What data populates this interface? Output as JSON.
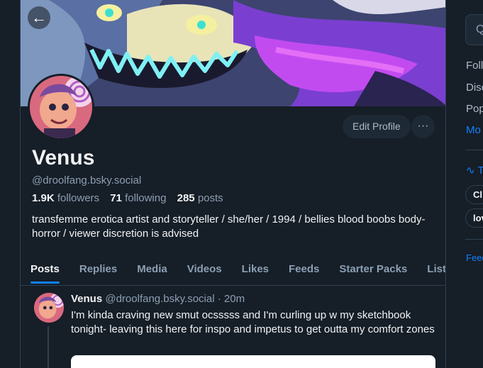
{
  "profile": {
    "display_name": "Venus",
    "handle": "@droolfang.bsky.social",
    "followers_count": "1.9K",
    "followers_label": "followers",
    "following_count": "71",
    "following_label": "following",
    "posts_count": "285",
    "posts_label": "posts",
    "bio": "transfemme erotica artist and storyteller / she/her / 1994 / bellies blood boobs body-horror / viewer discretion is advised",
    "edit_label": "Edit Profile",
    "more_label": "···",
    "back_icon": "arrow-left-icon"
  },
  "tabs": [
    "Posts",
    "Replies",
    "Media",
    "Videos",
    "Likes",
    "Feeds",
    "Starter Packs",
    "Lists"
  ],
  "post": {
    "author": "Venus",
    "handle": "@droolfang.bsky.social",
    "sep": "·",
    "time": "20m",
    "text": "I'm kinda craving new smut ocsssss and I'm curling up w my sketchbook tonight- leaving this here for inspo and impetus to get outta my comfort zones"
  },
  "sidebar": {
    "search_placeholder": "Q",
    "links": [
      "Foll",
      "Disc",
      "Pop",
      "Mo"
    ],
    "trending_label": "T",
    "pills": [
      "Cl",
      "lov"
    ],
    "footer": "Feed"
  },
  "colors": {
    "accent": "#1083fe",
    "background": "#161e27",
    "muted": "#8c9fb3"
  }
}
